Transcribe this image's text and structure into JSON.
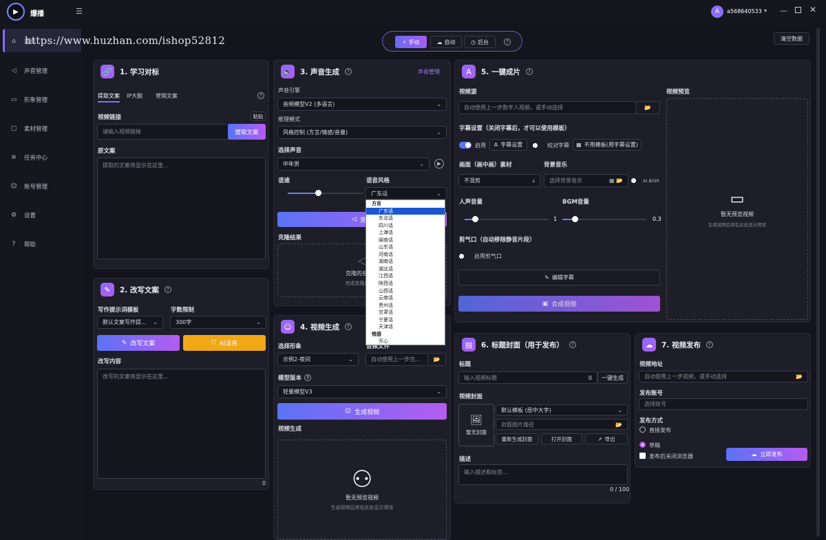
{
  "app": {
    "name": "爆播",
    "account": "a568640533",
    "avatar_letter": "A"
  },
  "watermark": "https://www.huzhan.com/ishop52812",
  "modes": {
    "manual": "手动",
    "auto": "自动",
    "background": "后台"
  },
  "clear_button": "清空数据",
  "sidebar": {
    "items": [
      {
        "label": "首页",
        "icon": "home-icon"
      },
      {
        "label": "声音管理",
        "icon": "sound-icon"
      },
      {
        "label": "形象管理",
        "icon": "video-icon"
      },
      {
        "label": "素材管理",
        "icon": "folder-icon"
      },
      {
        "label": "任务中心",
        "icon": "list-icon"
      },
      {
        "label": "账号管理",
        "icon": "user-icon"
      },
      {
        "label": "设置",
        "icon": "gear-icon"
      },
      {
        "label": "帮助",
        "icon": "help-icon"
      }
    ]
  },
  "p1": {
    "title": "1. 学习对标",
    "tabs": [
      "提取文案",
      "IP大脑",
      "营销文案"
    ],
    "link_label": "视频链接",
    "paste": "粘贴",
    "link_placeholder": "请输入视频链接",
    "extract_btn": "提取文案",
    "orig_label": "原文案",
    "orig_placeholder": "提取的文案将显示在这里..."
  },
  "p2": {
    "title": "2. 改写文案",
    "template_label": "写作提示词模板",
    "limit_label": "字数限制",
    "template_value": "默认文案写作提...",
    "limit_value": "300字",
    "rewrite_btn": "改写文案",
    "ai_btn": "AI法务",
    "content_label": "改写内容",
    "content_placeholder": "改写的文案将显示在这里...",
    "count": "0"
  },
  "p3": {
    "title": "3. 声音生成",
    "link": "声音管理",
    "engine_label": "声音引擎",
    "engine_value": "音频模型V2 (多语言)",
    "mode_label": "推理模式",
    "mode_value": "风格控制 (方言/情感/音量)",
    "voice_label": "选择声音",
    "voice_value": "中年男",
    "speed_label": "语速",
    "style_label": "语音风格",
    "style_value": "广东话",
    "clone_btn": "克隆",
    "result_label": "克隆结果",
    "result_text": "克隆的音频将",
    "result_sub": "完成克隆后可在"
  },
  "dropdown": {
    "group1": "方言",
    "options": [
      "广东话",
      "东北话",
      "四川话",
      "上海话",
      "闽南话",
      "山东话",
      "河南话",
      "湖南话",
      "湖北话",
      "江西话",
      "陕西话",
      "山西话",
      "云南话",
      "贵州话",
      "甘肃话",
      "宁夏话",
      "天津话"
    ],
    "group2": "情感",
    "options2": [
      "开心"
    ]
  },
  "p4": {
    "title": "4. 视频生成",
    "figure_label": "选择形象",
    "figure_value": "示例2-夜间",
    "audio_label": "音频文件",
    "audio_placeholder": "自动使用上一步克...",
    "version_label": "模型版本",
    "version_value": "轻量模型V3",
    "gen_btn": "生成视频",
    "video_label": "视频生成",
    "empty_text": "暂无预览视频",
    "empty_sub": "生成视频后将在此处显示预览"
  },
  "p5": {
    "title": "5. 一键成片",
    "video_src_label": "视频源",
    "video_src_placeholder": "自动使用上一步数字人视频，或手动选择",
    "subtitle_label": "字幕设置（关闭字幕后，才可以使用模板）",
    "enable": "启用",
    "subtitle_settings": "字幕设置",
    "proofread": "校对字幕",
    "no_template": "不用模板(用字幕设置)",
    "pip_label": "画面（画中画）素材",
    "pip_value": "不混剪",
    "bgm_label": "背景音乐",
    "bgm_placeholder": "选择背景音乐",
    "ai_bgm": "AI BGM",
    "voice_vol_label": "人声音量",
    "voice_vol": "1",
    "bgm_vol_label": "BGM音量",
    "bgm_vol": "0.3",
    "cut_label": "剪气口（自动移除静音片段）",
    "cut_enable": "启用剪气口",
    "edit_btn": "编辑字幕",
    "render_btn": "合成视频",
    "preview_label": "视频预览",
    "preview_empty": "暂无预览视频",
    "preview_sub": "生成视频后将在此处显示预览"
  },
  "p6": {
    "title": "6. 标题封面（用于发布）",
    "title_label": "标题",
    "title_placeholder": "输入视频标题",
    "title_count": "0",
    "gen_btn": "一键生成",
    "cover_label": "视频封面",
    "no_cover": "暂无封面",
    "template_value": "默认模板 (居中大字)",
    "cover_path_placeholder": "封面图片路径",
    "regen_btn": "重新生成封面",
    "open_btn": "打开封面",
    "export_btn": "导出",
    "desc_label": "描述",
    "desc_placeholder": "输入描述和标签...",
    "desc_count": "0 / 100"
  },
  "p7": {
    "title": "7. 视频发布",
    "addr_label": "视频地址",
    "addr_placeholder": "自动使用上一步视频，或手动选择",
    "account_label": "发布账号",
    "account_placeholder": "选择账号",
    "method_label": "发布方式",
    "direct": "直接发布",
    "draft": "草稿",
    "close_browser": "发布后关闭浏览器",
    "publish_btn": "立即发布"
  }
}
